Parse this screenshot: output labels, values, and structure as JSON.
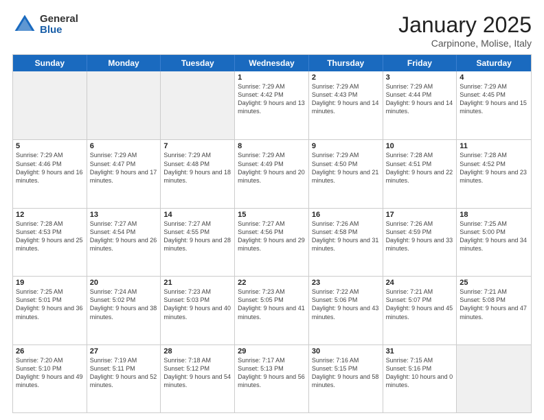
{
  "logo": {
    "general": "General",
    "blue": "Blue"
  },
  "title": "January 2025",
  "location": "Carpinone, Molise, Italy",
  "header_days": [
    "Sunday",
    "Monday",
    "Tuesday",
    "Wednesday",
    "Thursday",
    "Friday",
    "Saturday"
  ],
  "weeks": [
    [
      {
        "day": "",
        "info": "",
        "empty": true
      },
      {
        "day": "",
        "info": "",
        "empty": true
      },
      {
        "day": "",
        "info": "",
        "empty": true
      },
      {
        "day": "1",
        "info": "Sunrise: 7:29 AM\nSunset: 4:42 PM\nDaylight: 9 hours and 13 minutes."
      },
      {
        "day": "2",
        "info": "Sunrise: 7:29 AM\nSunset: 4:43 PM\nDaylight: 9 hours and 14 minutes."
      },
      {
        "day": "3",
        "info": "Sunrise: 7:29 AM\nSunset: 4:44 PM\nDaylight: 9 hours and 14 minutes."
      },
      {
        "day": "4",
        "info": "Sunrise: 7:29 AM\nSunset: 4:45 PM\nDaylight: 9 hours and 15 minutes."
      }
    ],
    [
      {
        "day": "5",
        "info": "Sunrise: 7:29 AM\nSunset: 4:46 PM\nDaylight: 9 hours and 16 minutes."
      },
      {
        "day": "6",
        "info": "Sunrise: 7:29 AM\nSunset: 4:47 PM\nDaylight: 9 hours and 17 minutes."
      },
      {
        "day": "7",
        "info": "Sunrise: 7:29 AM\nSunset: 4:48 PM\nDaylight: 9 hours and 18 minutes."
      },
      {
        "day": "8",
        "info": "Sunrise: 7:29 AM\nSunset: 4:49 PM\nDaylight: 9 hours and 20 minutes."
      },
      {
        "day": "9",
        "info": "Sunrise: 7:29 AM\nSunset: 4:50 PM\nDaylight: 9 hours and 21 minutes."
      },
      {
        "day": "10",
        "info": "Sunrise: 7:28 AM\nSunset: 4:51 PM\nDaylight: 9 hours and 22 minutes."
      },
      {
        "day": "11",
        "info": "Sunrise: 7:28 AM\nSunset: 4:52 PM\nDaylight: 9 hours and 23 minutes."
      }
    ],
    [
      {
        "day": "12",
        "info": "Sunrise: 7:28 AM\nSunset: 4:53 PM\nDaylight: 9 hours and 25 minutes."
      },
      {
        "day": "13",
        "info": "Sunrise: 7:27 AM\nSunset: 4:54 PM\nDaylight: 9 hours and 26 minutes."
      },
      {
        "day": "14",
        "info": "Sunrise: 7:27 AM\nSunset: 4:55 PM\nDaylight: 9 hours and 28 minutes."
      },
      {
        "day": "15",
        "info": "Sunrise: 7:27 AM\nSunset: 4:56 PM\nDaylight: 9 hours and 29 minutes."
      },
      {
        "day": "16",
        "info": "Sunrise: 7:26 AM\nSunset: 4:58 PM\nDaylight: 9 hours and 31 minutes."
      },
      {
        "day": "17",
        "info": "Sunrise: 7:26 AM\nSunset: 4:59 PM\nDaylight: 9 hours and 33 minutes."
      },
      {
        "day": "18",
        "info": "Sunrise: 7:25 AM\nSunset: 5:00 PM\nDaylight: 9 hours and 34 minutes."
      }
    ],
    [
      {
        "day": "19",
        "info": "Sunrise: 7:25 AM\nSunset: 5:01 PM\nDaylight: 9 hours and 36 minutes."
      },
      {
        "day": "20",
        "info": "Sunrise: 7:24 AM\nSunset: 5:02 PM\nDaylight: 9 hours and 38 minutes."
      },
      {
        "day": "21",
        "info": "Sunrise: 7:23 AM\nSunset: 5:03 PM\nDaylight: 9 hours and 40 minutes."
      },
      {
        "day": "22",
        "info": "Sunrise: 7:23 AM\nSunset: 5:05 PM\nDaylight: 9 hours and 41 minutes."
      },
      {
        "day": "23",
        "info": "Sunrise: 7:22 AM\nSunset: 5:06 PM\nDaylight: 9 hours and 43 minutes."
      },
      {
        "day": "24",
        "info": "Sunrise: 7:21 AM\nSunset: 5:07 PM\nDaylight: 9 hours and 45 minutes."
      },
      {
        "day": "25",
        "info": "Sunrise: 7:21 AM\nSunset: 5:08 PM\nDaylight: 9 hours and 47 minutes."
      }
    ],
    [
      {
        "day": "26",
        "info": "Sunrise: 7:20 AM\nSunset: 5:10 PM\nDaylight: 9 hours and 49 minutes."
      },
      {
        "day": "27",
        "info": "Sunrise: 7:19 AM\nSunset: 5:11 PM\nDaylight: 9 hours and 52 minutes."
      },
      {
        "day": "28",
        "info": "Sunrise: 7:18 AM\nSunset: 5:12 PM\nDaylight: 9 hours and 54 minutes."
      },
      {
        "day": "29",
        "info": "Sunrise: 7:17 AM\nSunset: 5:13 PM\nDaylight: 9 hours and 56 minutes."
      },
      {
        "day": "30",
        "info": "Sunrise: 7:16 AM\nSunset: 5:15 PM\nDaylight: 9 hours and 58 minutes."
      },
      {
        "day": "31",
        "info": "Sunrise: 7:15 AM\nSunset: 5:16 PM\nDaylight: 10 hours and 0 minutes."
      },
      {
        "day": "",
        "info": "",
        "empty": true
      }
    ]
  ]
}
